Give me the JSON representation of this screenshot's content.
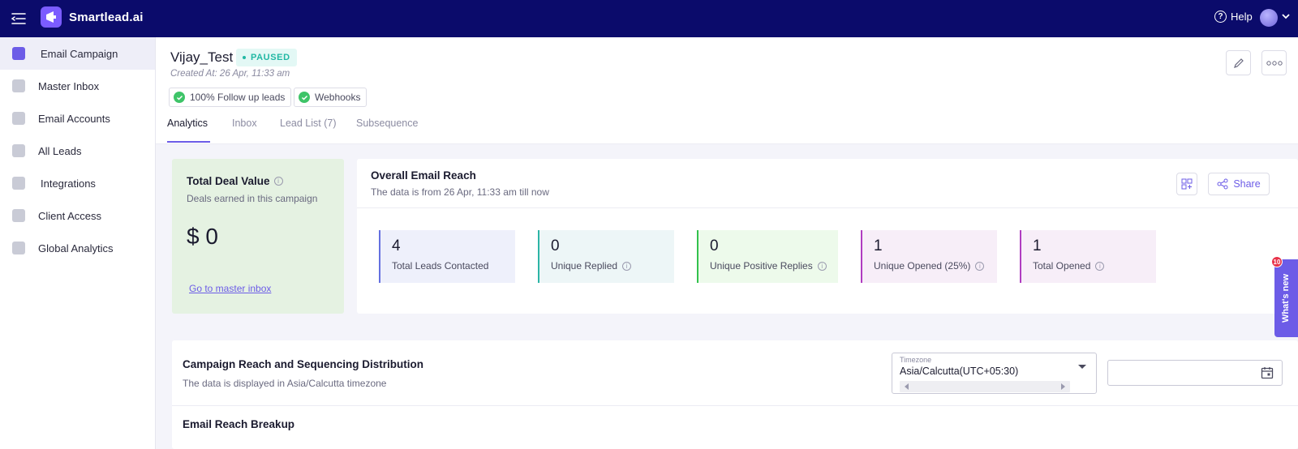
{
  "app": {
    "brand": "Smartlead.ai",
    "help_label": "Help"
  },
  "sidebar": {
    "items": [
      {
        "label": "Email Campaign",
        "icon": "megaphone-icon",
        "active": true
      },
      {
        "label": "Master Inbox",
        "icon": "inbox-icon"
      },
      {
        "label": "Email Accounts",
        "icon": "mail-icon"
      },
      {
        "label": "All Leads",
        "icon": "leads-icon"
      },
      {
        "label": "Integrations",
        "icon": "puzzle-icon"
      },
      {
        "label": "Client Access",
        "icon": "bolt-icon"
      },
      {
        "label": "Global Analytics",
        "icon": "bar-chart-icon"
      }
    ]
  },
  "campaign": {
    "name": "Vijay_Test",
    "status": "PAUSED",
    "created": "Created At: 26 Apr, 11:33 am",
    "chips": [
      "100% Follow up leads",
      "Webhooks"
    ]
  },
  "tabs": [
    "Analytics",
    "Inbox",
    "Lead List (7)",
    "Subsequence"
  ],
  "deal": {
    "title": "Total Deal Value",
    "subtitle": "Deals earned in this campaign",
    "value": "$ 0",
    "link": "Go to master inbox"
  },
  "reach": {
    "title": "Overall Email Reach",
    "subtitle": "The data is from 26 Apr, 11:33 am till now",
    "share_label": "Share",
    "stats": [
      {
        "value": "4",
        "label": "Total Leads Contacted",
        "info": false,
        "color": "#6470e0",
        "bg": "#eef0fb"
      },
      {
        "value": "0",
        "label": "Unique Replied",
        "info": true,
        "color": "#2cb5a6",
        "bg": "#edf6f7"
      },
      {
        "value": "0",
        "label": "Unique Positive Replies",
        "info": true,
        "color": "#33c24d",
        "bg": "#edfaeb"
      },
      {
        "value": "1",
        "label": "Unique Opened (25%)",
        "info": true,
        "color": "#b03cc0",
        "bg": "#f7eef8"
      },
      {
        "value": "1",
        "label": "Total Opened",
        "info": true,
        "color": "#b03cc0",
        "bg": "#f7eef8"
      }
    ]
  },
  "whats_new": {
    "label": "What's new",
    "badge": "10"
  },
  "distribution": {
    "title": "Campaign Reach and Sequencing Distribution",
    "subtitle": "The data is displayed in Asia/Calcutta timezone",
    "timezone_label": "Timezone",
    "timezone_value": "Asia/Calcutta(UTC+05:30)",
    "breakup_title": "Email Reach Breakup"
  },
  "colors": {
    "topbar": "#0b0b6b",
    "accent": "#6c5ce7",
    "deal_bg": "#e5f2e2"
  }
}
